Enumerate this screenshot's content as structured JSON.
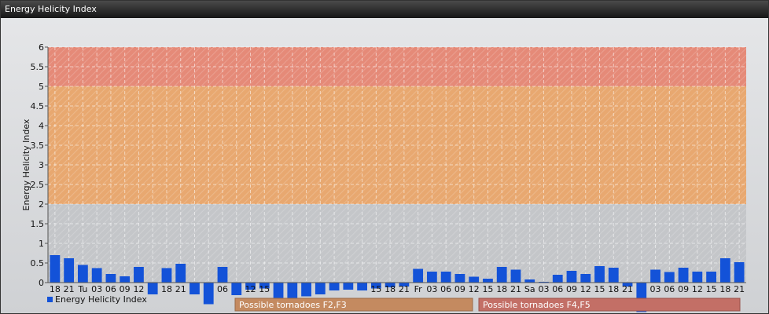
{
  "window": {
    "title": "Energy Helicity Index"
  },
  "chart_data": {
    "type": "bar",
    "ylabel": "Energy Helicity Index",
    "ylim": [
      0,
      6
    ],
    "yticks": [
      "0",
      "0.5",
      "1",
      "1.5",
      "2",
      "2.5",
      "3",
      "3.5",
      "4",
      "4.5",
      "5",
      "5.5",
      "6"
    ],
    "grid": true,
    "risk_bands": [
      {
        "from": 2,
        "to": 5,
        "color": "#e8a870"
      },
      {
        "from": 5,
        "to": 6,
        "color": "#e58a78"
      }
    ],
    "categories": [
      "18",
      "21",
      "Tu",
      "03",
      "06",
      "09",
      "12",
      "",
      "18",
      "21",
      "",
      "",
      "06",
      "",
      "12",
      "15",
      "",
      "",
      "",
      "",
      "",
      "",
      "",
      "15",
      "18",
      "21",
      "Fr",
      "03",
      "06",
      "09",
      "12",
      "15",
      "18",
      "21",
      "Sa",
      "03",
      "06",
      "09",
      "12",
      "15",
      "18",
      "21",
      "",
      "03",
      "06",
      "09",
      "12",
      "15",
      "18",
      "21"
    ],
    "series": [
      {
        "name": "Energy Helicity Index",
        "color": "#1352d8",
        "values": [
          0.7,
          0.62,
          0.45,
          0.37,
          0.22,
          0.16,
          0.4,
          -0.3,
          0.37,
          0.48,
          -0.3,
          -0.55,
          0.4,
          -0.32,
          -0.18,
          -0.15,
          -0.4,
          -0.55,
          -0.35,
          -0.3,
          -0.2,
          -0.18,
          -0.2,
          -0.15,
          -0.12,
          -0.1,
          0.35,
          0.28,
          0.28,
          0.22,
          0.15,
          0.1,
          0.4,
          0.33,
          0.08,
          0.02,
          0.2,
          0.3,
          0.22,
          0.42,
          0.38,
          -0.1,
          -0.75,
          0.33,
          0.27,
          0.38,
          0.28,
          0.28,
          0.62,
          0.52
        ]
      }
    ],
    "legend": {
      "label": "Energy Helicity Index",
      "position": "bottom-left"
    },
    "annotations": [
      {
        "label": "Possible tornadoes F2,F3",
        "color": "#c48a60"
      },
      {
        "label": "Possible tornadoes F4,F5",
        "color": "#c36f66"
      }
    ]
  }
}
